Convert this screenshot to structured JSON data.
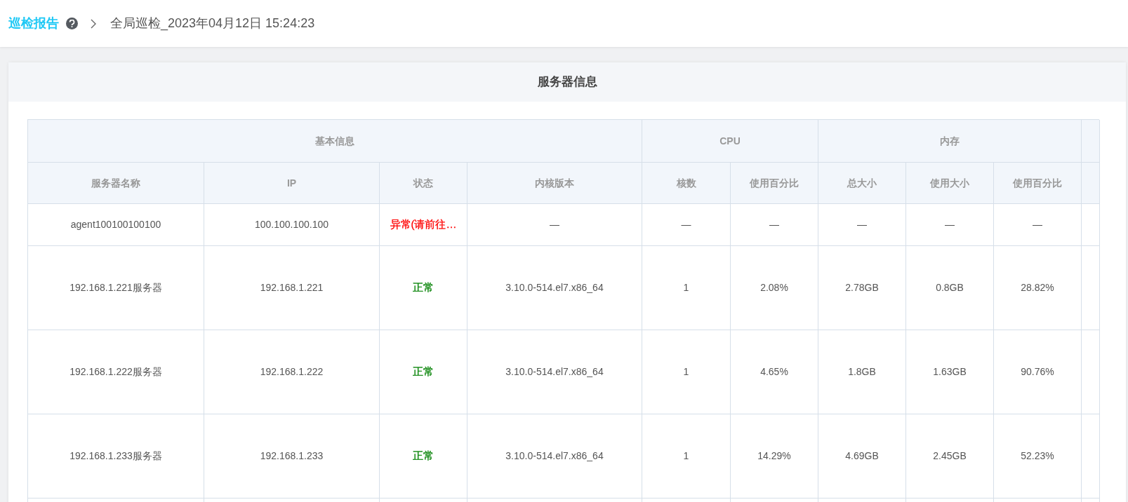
{
  "breadcrumb": {
    "title": "巡检报告",
    "current": "全局巡检_2023年04月12日 15:24:23"
  },
  "card": {
    "title": "服务器信息"
  },
  "table": {
    "groups": [
      "基本信息",
      "CPU",
      "内存"
    ],
    "columns": [
      "服务器名称",
      "IP",
      "状态",
      "内核版本",
      "核数",
      "使用百分比",
      "总大小",
      "使用大小",
      "使用百分比"
    ],
    "rows": [
      {
        "cells": [
          "agent100100100100",
          "100.100.100.100",
          "异常(请前往…",
          "—",
          "—",
          "—",
          "—",
          "—",
          "—"
        ],
        "color": "#ff0000"
      },
      {
        "cells": [
          "192.168.1.221服务器",
          "192.168.1.221",
          "正常",
          "3.10.0-514.el7.x86_64",
          "1",
          "2.08%",
          "2.78GB",
          "0.8GB",
          "28.82%"
        ],
        "color": "#008000"
      },
      {
        "cells": [
          "192.168.1.222服务器",
          "192.168.1.222",
          "正常",
          "3.10.0-514.el7.x86_64",
          "1",
          "4.65%",
          "1.8GB",
          "1.63GB",
          "90.76%"
        ],
        "color": "#008000"
      },
      {
        "cells": [
          "192.168.1.233服务器",
          "192.168.1.233",
          "正常",
          "3.10.0-514.el7.x86_64",
          "1",
          "14.29%",
          "4.69GB",
          "2.45GB",
          "52.23%"
        ],
        "color": "#008000"
      }
    ]
  }
}
